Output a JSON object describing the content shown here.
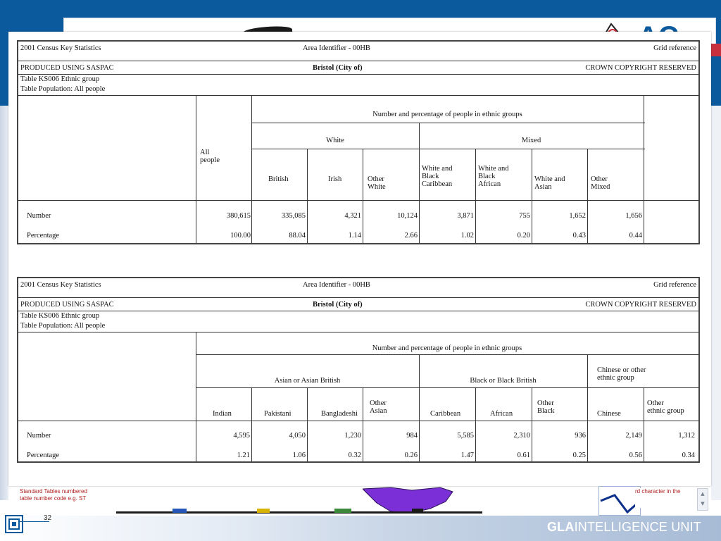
{
  "tables": [
    {
      "title_left": "2001 Census Key Statistics",
      "area_identifier": "Area Identifier - 00HB",
      "grid_ref": "Grid reference",
      "produced": "PRODUCED USING SASPAC",
      "area_name": "Bristol (City of)",
      "copyright": "CROWN COPYRIGHT RESERVED",
      "table_name": "Table KS006 Ethnic group",
      "table_pop": "Table Population: All people",
      "super_header": "Number and percentage of people in ethnic groups",
      "all_people": "All\npeople",
      "groups": [
        "White",
        "Mixed"
      ],
      "columns": [
        "British",
        "Irish",
        "Other\nWhite",
        "White and\nBlack\nCaribbean",
        "White and\nBlack\nAfrican",
        "White and\nAsian",
        "Other\nMixed"
      ],
      "rows": [
        {
          "label": "Number",
          "values": [
            "380,615",
            "335,085",
            "4,321",
            "10,124",
            "3,871",
            "755",
            "1,652",
            "1,656"
          ]
        },
        {
          "label": "Percentage",
          "values": [
            "100.00",
            "88.04",
            "1.14",
            "2.66",
            "1.02",
            "0.20",
            "0.43",
            "0.44"
          ]
        }
      ]
    },
    {
      "title_left": "2001 Census Key Statistics",
      "area_identifier": "Area Identifier - 00HB",
      "grid_ref": "Grid reference",
      "produced": "PRODUCED USING SASPAC",
      "area_name": "Bristol (City of)",
      "copyright": "CROWN COPYRIGHT RESERVED",
      "table_name": "Table KS006 Ethnic group",
      "table_pop": "Table Population: All people",
      "super_header": "Number and percentage of people in ethnic groups",
      "groups": [
        "Asian or Asian British",
        "Black or Black British",
        "Chinese or other\nethnic group"
      ],
      "columns": [
        "Indian",
        "Pakistani",
        "Bangladeshi",
        "Other\nAsian",
        "Caribbean",
        "African",
        "Other\nBlack",
        "Chinese",
        "Other\nethnic group"
      ],
      "rows": [
        {
          "label": "Number",
          "values": [
            "4,595",
            "4,050",
            "1,230",
            "984",
            "5,585",
            "2,310",
            "936",
            "2,149",
            "1,312"
          ]
        },
        {
          "label": "Percentage",
          "values": [
            "1.21",
            "1.06",
            "0.32",
            "0.26",
            "1.47",
            "0.61",
            "0.25",
            "0.56",
            "0.34"
          ]
        }
      ]
    }
  ],
  "footer": {
    "unit_bold": "GLA",
    "unit_rest": "INTELLIGENCE UNIT",
    "slide_number": "32",
    "note_left": "Standard Tables numbered\ntable number code e.g. ST",
    "note_right": "rd character in the",
    "scroll_up": "▲",
    "scroll_down": "▼"
  },
  "header": {
    "logo_text": "AC"
  },
  "colors": {
    "header_blue": "#0c5a9e",
    "note_red": "#b01e1e",
    "map_purple": "#7b2fd6"
  }
}
